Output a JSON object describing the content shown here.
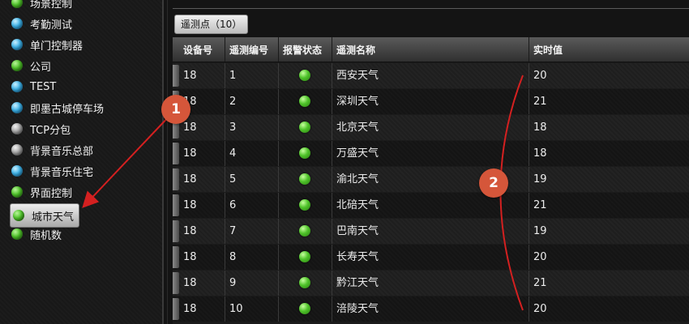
{
  "sidebar": {
    "items": [
      {
        "label": "场景控制",
        "color": "green"
      },
      {
        "label": "考勤测试",
        "color": "blue"
      },
      {
        "label": "单门控制器",
        "color": "blue"
      },
      {
        "label": "公司",
        "color": "green"
      },
      {
        "label": "TEST",
        "color": "blue"
      },
      {
        "label": "即墨古城停车场",
        "color": "blue"
      },
      {
        "label": "TCP分包",
        "color": "gray"
      },
      {
        "label": "背景音乐总部",
        "color": "gray"
      },
      {
        "label": "背景音乐住宅",
        "color": "blue"
      },
      {
        "label": "界面控制",
        "color": "green"
      },
      {
        "label": "城市天气",
        "color": "green",
        "selected": true
      },
      {
        "label": "随机数",
        "color": "green"
      }
    ]
  },
  "tab": {
    "label": "遥测点（10）"
  },
  "table": {
    "columns": [
      "设备号",
      "遥测编号",
      "报警状态",
      "遥测名称",
      "实时值"
    ],
    "rows": [
      {
        "device": "18",
        "id": "1",
        "alarm": "normal",
        "name": "西安天气",
        "value": "20"
      },
      {
        "device": "18",
        "id": "2",
        "alarm": "normal",
        "name": "深圳天气",
        "value": "21"
      },
      {
        "device": "18",
        "id": "3",
        "alarm": "normal",
        "name": "北京天气",
        "value": "18"
      },
      {
        "device": "18",
        "id": "4",
        "alarm": "normal",
        "name": "万盛天气",
        "value": "18"
      },
      {
        "device": "18",
        "id": "5",
        "alarm": "normal",
        "name": "渝北天气",
        "value": "19"
      },
      {
        "device": "18",
        "id": "6",
        "alarm": "normal",
        "name": "北碚天气",
        "value": "21"
      },
      {
        "device": "18",
        "id": "7",
        "alarm": "normal",
        "name": "巴南天气",
        "value": "19"
      },
      {
        "device": "18",
        "id": "8",
        "alarm": "normal",
        "name": "长寿天气",
        "value": "20"
      },
      {
        "device": "18",
        "id": "9",
        "alarm": "normal",
        "name": "黔江天气",
        "value": "21"
      },
      {
        "device": "18",
        "id": "10",
        "alarm": "normal",
        "name": "涪陵天气",
        "value": "20"
      }
    ]
  },
  "annotations": {
    "badge1": "1",
    "badge2": "2",
    "color": "#d5563a",
    "arrow_color": "#d42020"
  }
}
